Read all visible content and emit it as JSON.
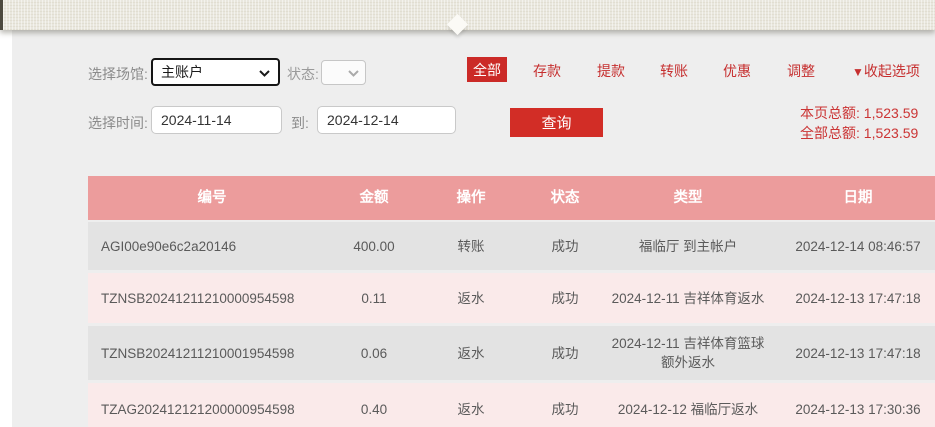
{
  "filters": {
    "venue_label": "选择场馆:",
    "venue_value": "主账户",
    "status_label": "状态:",
    "tabs": [
      {
        "label": "全部",
        "active": true
      },
      {
        "label": "存款",
        "active": false
      },
      {
        "label": "提款",
        "active": false
      },
      {
        "label": "转账",
        "active": false
      },
      {
        "label": "优惠",
        "active": false
      },
      {
        "label": "调整",
        "active": false
      }
    ],
    "collapse_icon": "▼",
    "collapse_label": "收起选项"
  },
  "date_filter": {
    "label": "选择时间:",
    "from": "2024-11-14",
    "to_label": "到:",
    "to": "2024-12-14",
    "search_label": "查询"
  },
  "totals": {
    "page_line": "本页总额: 1,523.59",
    "all_line": "全部总额: 1,523.59"
  },
  "table": {
    "headers": [
      "编号",
      "金额",
      "操作",
      "状态",
      "类型",
      "日期"
    ],
    "rows": [
      {
        "id": "AGI00e90e6c2a20146",
        "amount": "400.00",
        "operation": "转账",
        "status": "成功",
        "type": "福临厅 到主帐户",
        "date": "2024-12-14 08:46:57"
      },
      {
        "id": "TZNSB20241211210000954598",
        "amount": "0.11",
        "operation": "返水",
        "status": "成功",
        "type": "2024-12-11 吉祥体育返水",
        "date": "2024-12-13 17:47:18"
      },
      {
        "id": "TZNSB20241211210001954598",
        "amount": "0.06",
        "operation": "返水",
        "status": "成功",
        "type": "2024-12-11 吉祥体育篮球额外返水",
        "date": "2024-12-13 17:47:18"
      },
      {
        "id": "TZAG202412121200000954598",
        "amount": "0.40",
        "operation": "返水",
        "status": "成功",
        "type": "2024-12-12 福临厅返水",
        "date": "2024-12-13 17:30:36"
      }
    ]
  },
  "colors": {
    "accent_red": "#cb2a27",
    "header_pink": "#ec9c9c",
    "row_gray": "#e3e3e3",
    "row_pink": "#faeaea",
    "topbar_beige": "#e9e7de"
  }
}
